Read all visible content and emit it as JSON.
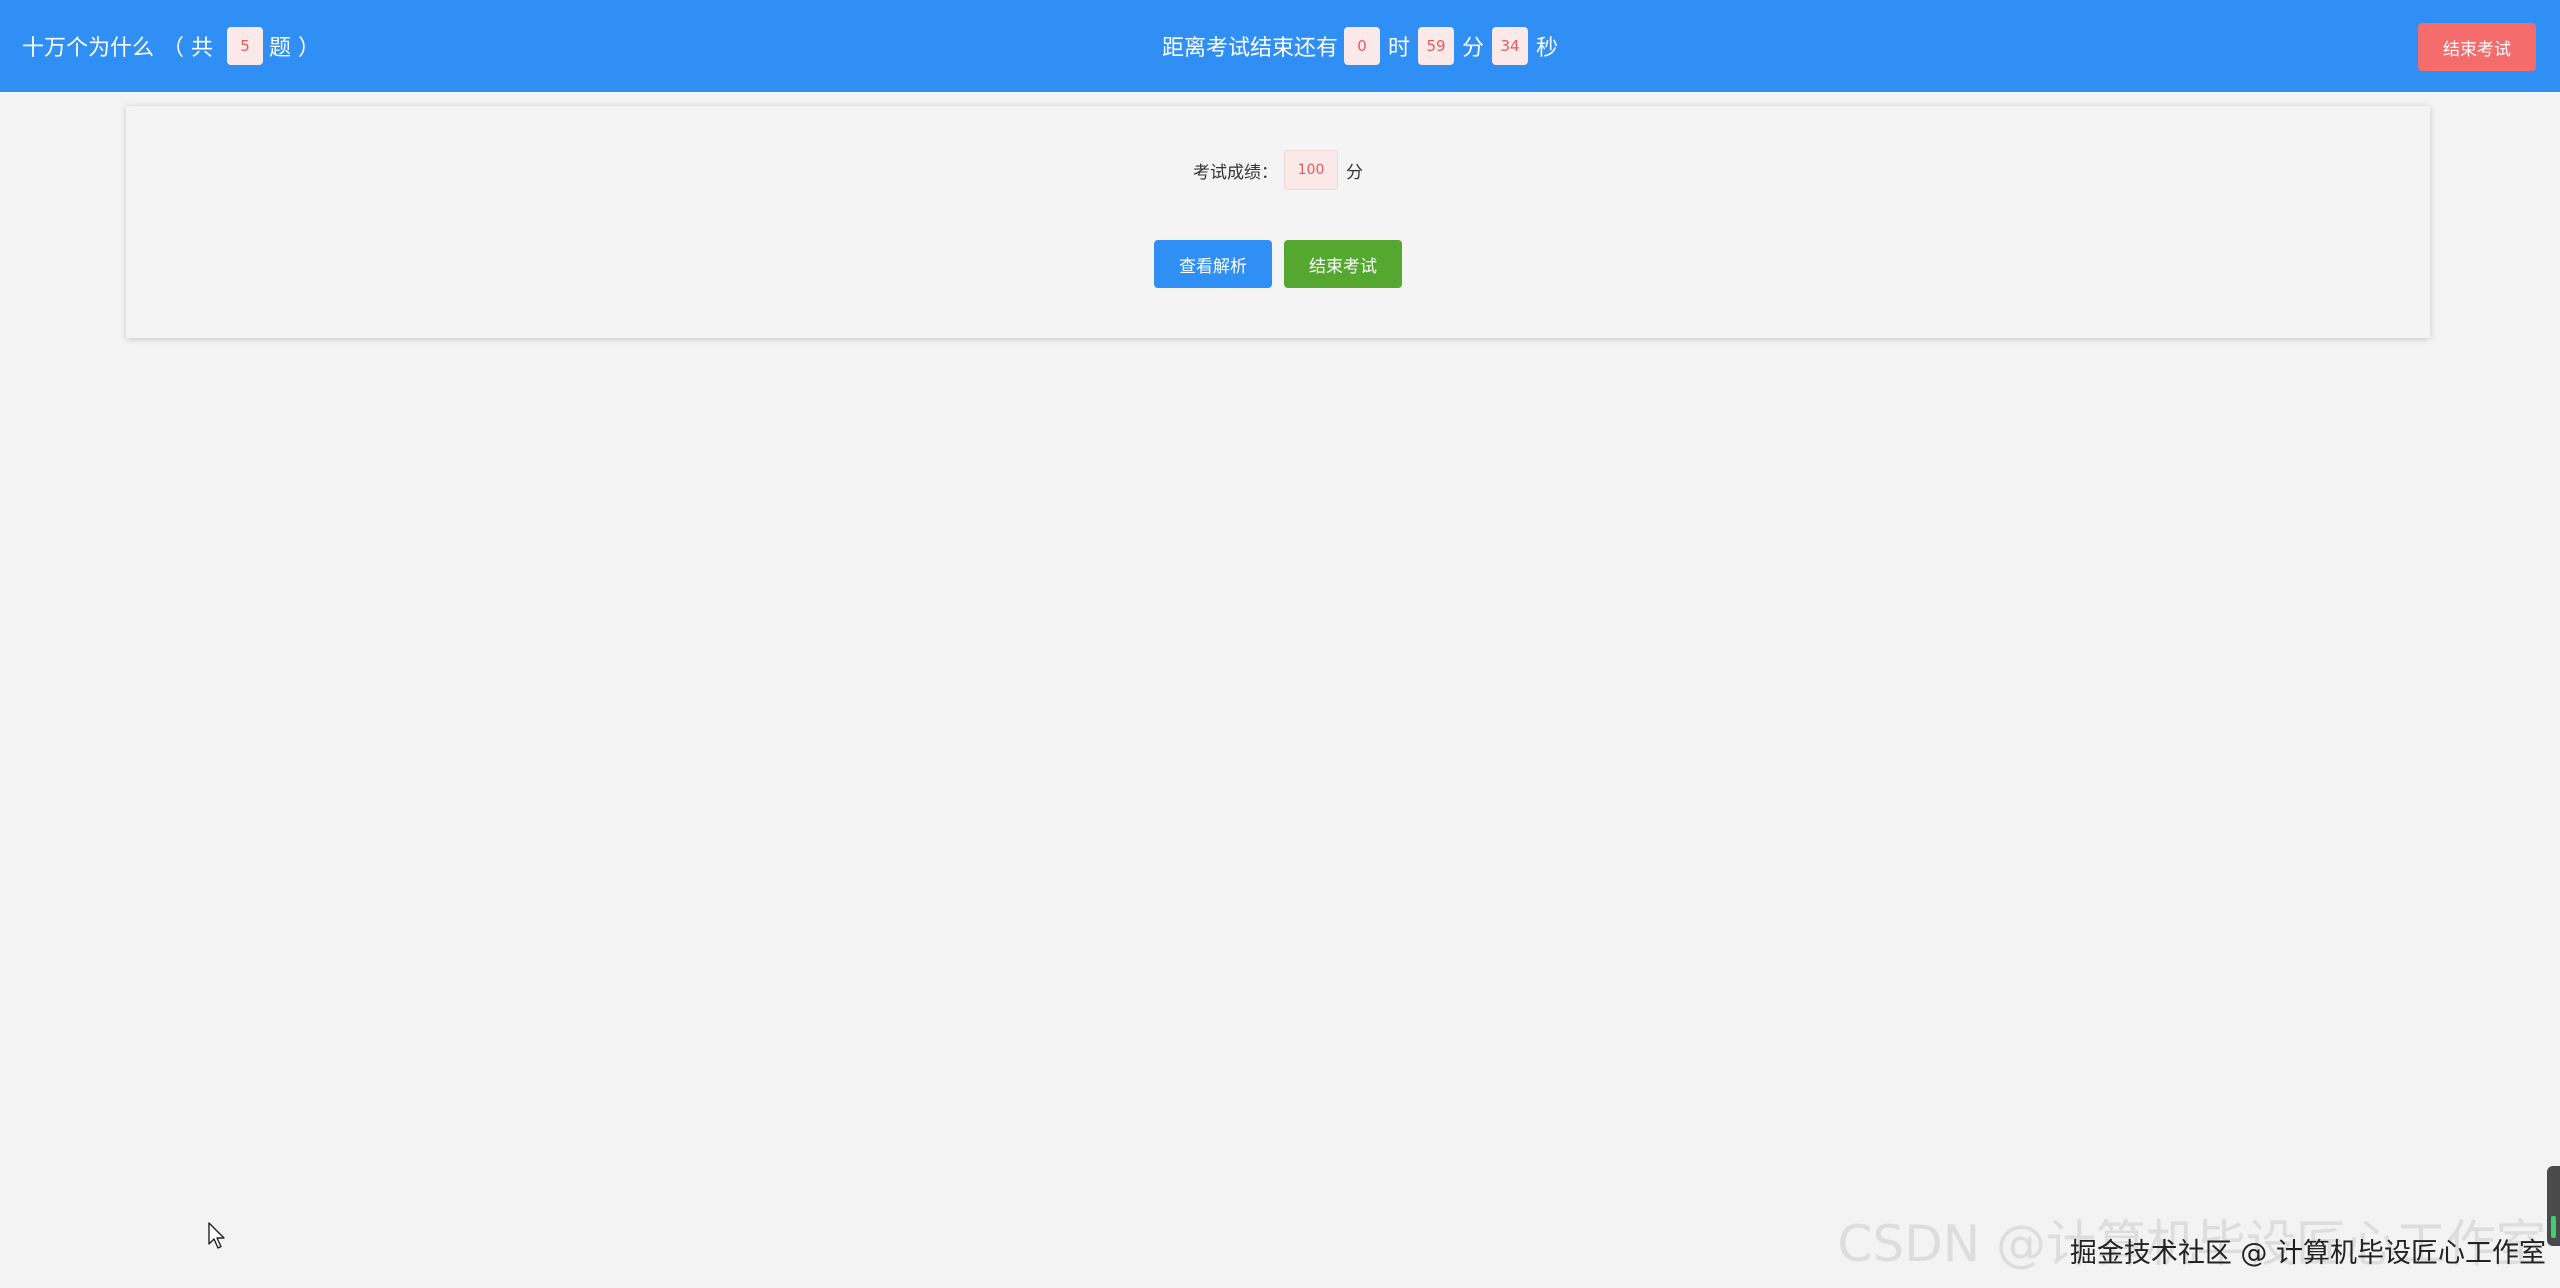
{
  "header": {
    "quiz_name": "十万个为什么",
    "count_open": "（ 共",
    "question_count": "5",
    "count_close": "题 ）",
    "countdown_prefix": "距离考试结束还有",
    "hours": "0",
    "hours_unit": "时",
    "minutes": "59",
    "minutes_unit": "分",
    "seconds": "34",
    "seconds_unit": "秒",
    "end_exam_label": "结束考试"
  },
  "result": {
    "score_label": "考试成绩：",
    "score": "100",
    "score_unit": "分",
    "view_analysis_label": "查看解析",
    "finish_exam_label": "结束考试"
  },
  "watermark": {
    "foreground": "掘金技术社区 @ 计算机毕设匠心工作室",
    "background": "CSDN @计算机毕设匠心工作室"
  },
  "colors": {
    "header_bg": "#2f8ff5",
    "danger": "#f56c6c",
    "primary": "#2f8ff5",
    "success": "#55a82f",
    "page_bg": "#f3f3f3"
  }
}
